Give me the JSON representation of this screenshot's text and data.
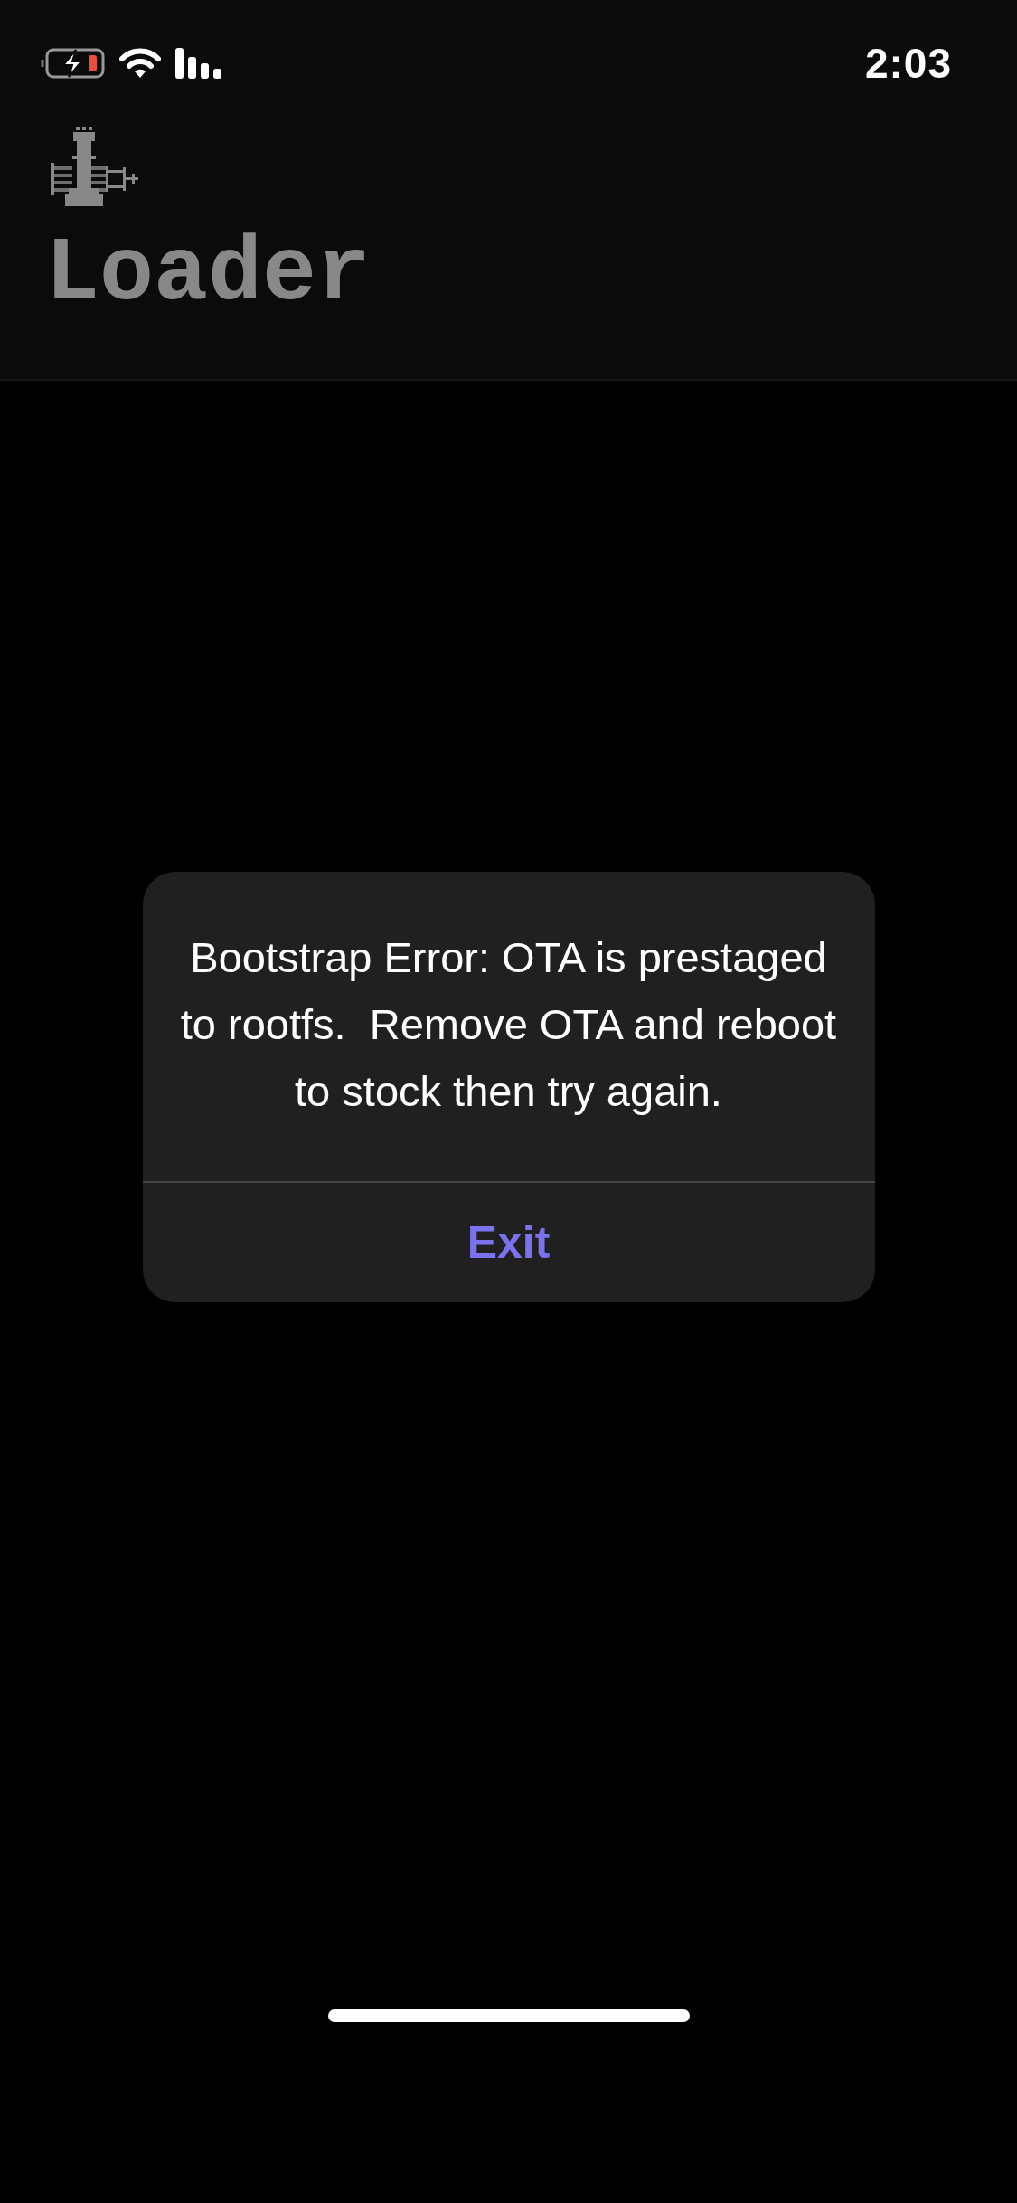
{
  "status_bar": {
    "time": "2:03"
  },
  "header": {
    "title": "Loader"
  },
  "alert": {
    "message": "Bootstrap Error: OTA is prestaged to rootfs.  Remove OTA and reboot to stock then try again.",
    "buttons": [
      {
        "label": "Exit"
      }
    ]
  }
}
